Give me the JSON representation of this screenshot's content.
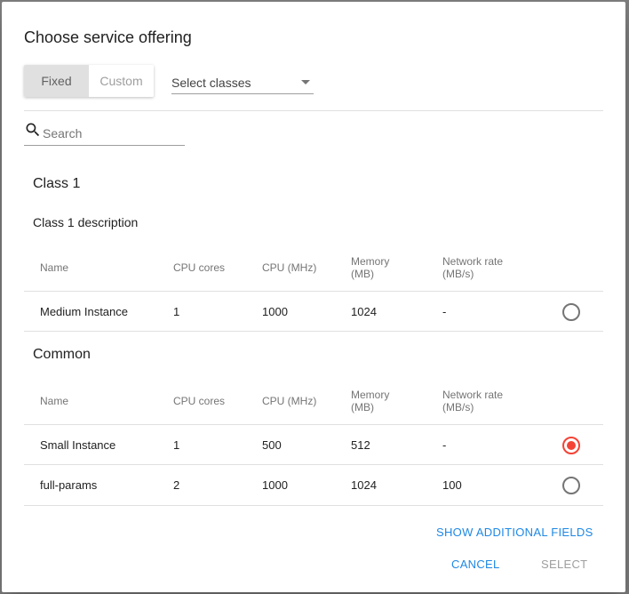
{
  "dialog": {
    "title": "Choose service offering",
    "mode_toggle": {
      "fixed_label": "Fixed",
      "custom_label": "Custom",
      "selected": "Fixed"
    },
    "class_select": {
      "placeholder": "Select classes"
    },
    "search": {
      "placeholder": "Search",
      "value": ""
    },
    "columns": [
      "Name",
      "CPU cores",
      "CPU (MHz)",
      "Memory (MB)",
      "Network rate (MB/s)"
    ],
    "groups": [
      {
        "title": "Class 1",
        "description": "Class 1 description",
        "rows": [
          {
            "name": "Medium Instance",
            "cpu_cores": "1",
            "cpu_mhz": "1000",
            "memory_mb": "1024",
            "network_rate": "-",
            "selected": false
          }
        ]
      },
      {
        "title": "Common",
        "rows": [
          {
            "name": "Small Instance",
            "cpu_cores": "1",
            "cpu_mhz": "500",
            "memory_mb": "512",
            "network_rate": "-",
            "selected": true
          },
          {
            "name": "full-params",
            "cpu_cores": "2",
            "cpu_mhz": "1000",
            "memory_mb": "1024",
            "network_rate": "100",
            "selected": false
          }
        ]
      }
    ],
    "buttons": {
      "show_additional": "SHOW ADDITIONAL FIELDS",
      "cancel": "CANCEL",
      "select": "SELECT"
    }
  },
  "colors": {
    "accent": "#1e88e5",
    "radio_selected": "#f44336",
    "toggle_active_bg": "#e0e0e0"
  },
  "icons": {
    "search": "search-icon",
    "dropdown": "chevron-down-icon"
  }
}
